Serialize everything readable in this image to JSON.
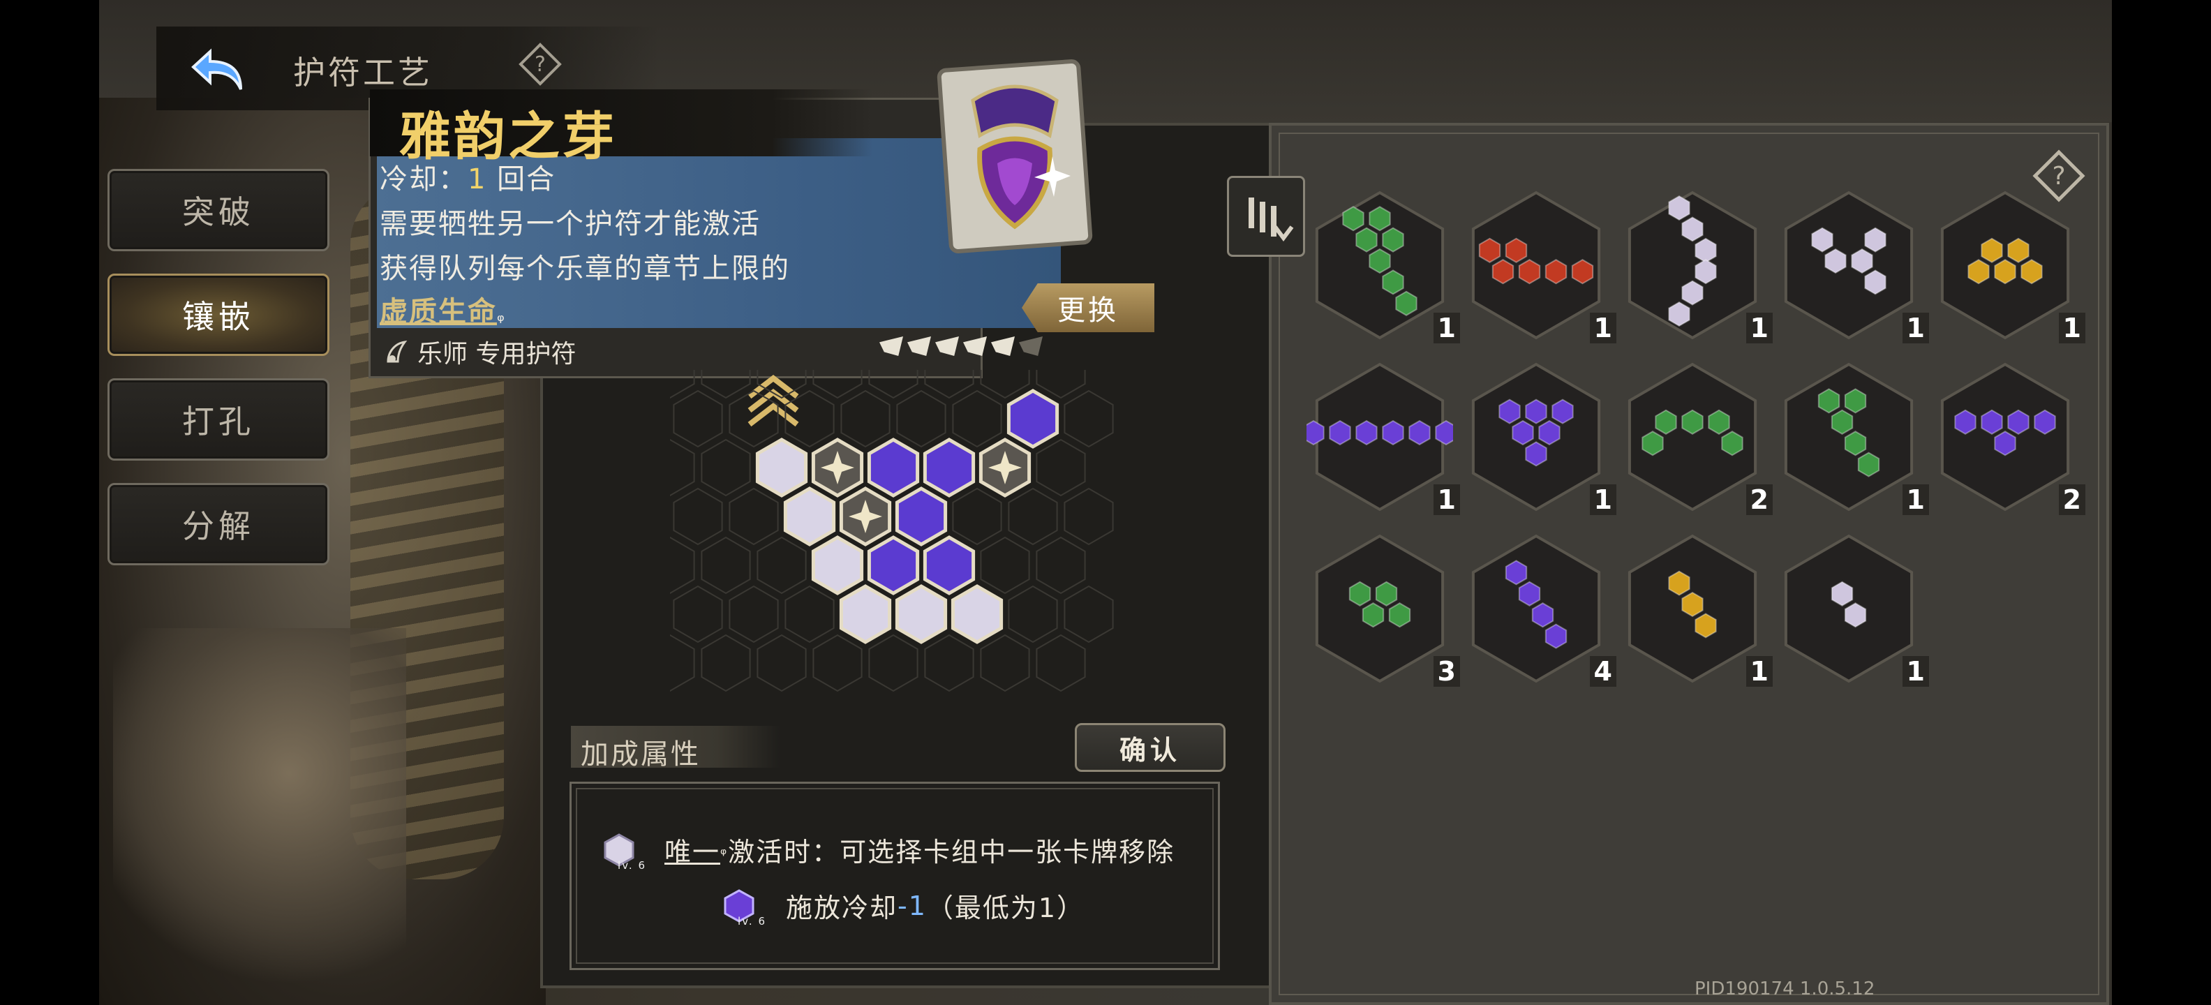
{
  "header": {
    "title": "护符工艺"
  },
  "menu": [
    {
      "label": "突破",
      "active": false
    },
    {
      "label": "镶嵌",
      "active": true
    },
    {
      "label": "打孔",
      "active": false
    },
    {
      "label": "分解",
      "active": false
    }
  ],
  "charm": {
    "name": "雅韵之芽",
    "cooldown_label": "冷却：",
    "cooldown_value": "1",
    "cooldown_unit": "回合",
    "desc1": "需要牺牲另一个护符才能激活",
    "desc2": "获得队列每个乐章的章节上限的",
    "desc3": "虚质生命",
    "class_text": "乐师 专用护符",
    "stars_filled": 5,
    "stars_total": 6,
    "swap_label": "更换"
  },
  "bonus": {
    "title": "加成属性",
    "confirm_label": "确认",
    "line1_keyword": "唯一",
    "line1_text": "激活时：可选择卡组中一张卡牌移除",
    "line1_level": "lv. 6",
    "line2_text_a": "施放冷却",
    "line2_value": "-1",
    "line2_text_b": "（最低为1）",
    "line2_level": "lv. 6"
  },
  "colors": {
    "green": "#3f9a44",
    "red": "#c23a22",
    "white": "#cfc6de",
    "yellow": "#d7a21e",
    "purple": "#6a3fd6"
  },
  "gem_slots": [
    {
      "color": "green",
      "count": "1"
    },
    {
      "color": "red",
      "count": "1"
    },
    {
      "color": "white",
      "count": "1"
    },
    {
      "color": "white",
      "count": "1"
    },
    {
      "color": "yellow",
      "count": "1"
    },
    {
      "color": "purple",
      "count": "1"
    },
    {
      "color": "purple",
      "count": "1"
    },
    {
      "color": "green",
      "count": "2"
    },
    {
      "color": "green",
      "count": "1"
    },
    {
      "color": "purple",
      "count": "2"
    },
    {
      "color": "green",
      "count": "3"
    },
    {
      "color": "purple",
      "count": "4"
    },
    {
      "color": "yellow",
      "count": "1"
    },
    {
      "color": "white",
      "count": "1"
    }
  ],
  "footer": {
    "pid": "PID190174  1.0.5.12"
  }
}
